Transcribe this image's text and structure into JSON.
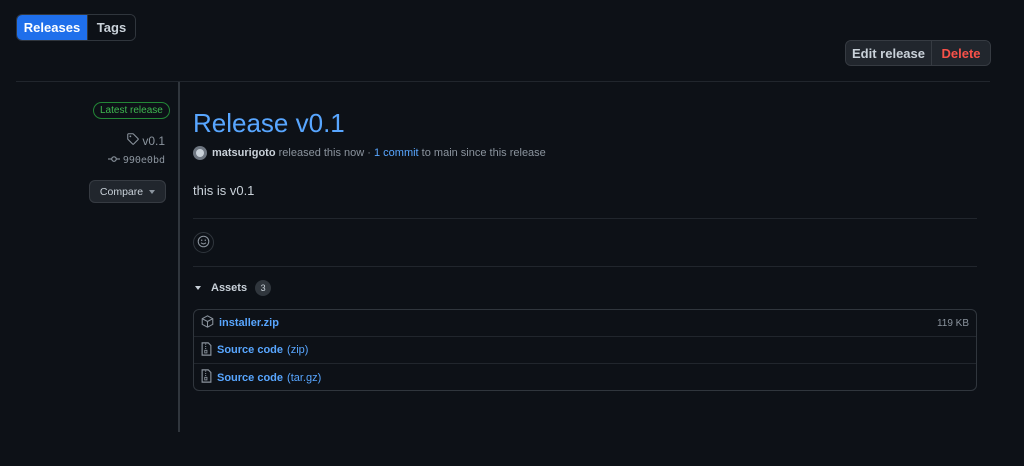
{
  "tabs": {
    "releases": "Releases",
    "tags": "Tags"
  },
  "actions": {
    "edit": "Edit release",
    "delete": "Delete"
  },
  "sidebar": {
    "badge": "Latest release",
    "tag": "v0.1",
    "commit": "990e0bd",
    "compare": "Compare"
  },
  "release": {
    "title": "Release v0.1",
    "author": "matsurigoto",
    "released_text": " released this now · ",
    "commits_link": "1 commit",
    "commits_suffix": " to main since this release",
    "body": "this is v0.1"
  },
  "assets": {
    "label": "Assets",
    "count": "3",
    "items": [
      {
        "name": "installer.zip",
        "ext": "",
        "size": "119 KB",
        "icon": "package-icon"
      },
      {
        "name": "Source code",
        "ext": "(zip)",
        "size": "",
        "icon": "file-zip-icon"
      },
      {
        "name": "Source code",
        "ext": "(tar.gz)",
        "size": "",
        "icon": "file-zip-icon"
      }
    ]
  },
  "colors": {
    "accent": "#1f6feb",
    "link": "#58a6ff",
    "danger": "#f85149",
    "success": "#3fb950",
    "background": "#0d1117"
  }
}
